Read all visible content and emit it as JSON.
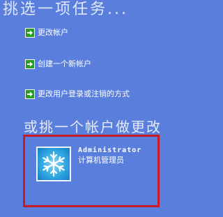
{
  "task_heading": "挑选一项任务...",
  "tasks": [
    {
      "label": "更改帐户",
      "icon": "green-arrow-icon"
    },
    {
      "label": "创建一个新帐户",
      "icon": "green-arrow-icon"
    },
    {
      "label": "更改用户登录或注销的方式",
      "icon": "green-arrow-icon"
    }
  ],
  "pick_heading": "或挑一个帐户做更改",
  "account": {
    "name": "Administrator",
    "role": "计算机管理员",
    "avatar": "snowflake-icon",
    "highlight_color": "#c71c26"
  },
  "colors": {
    "background": "#5a7edc",
    "arrow_green": "#2e9a2a"
  }
}
